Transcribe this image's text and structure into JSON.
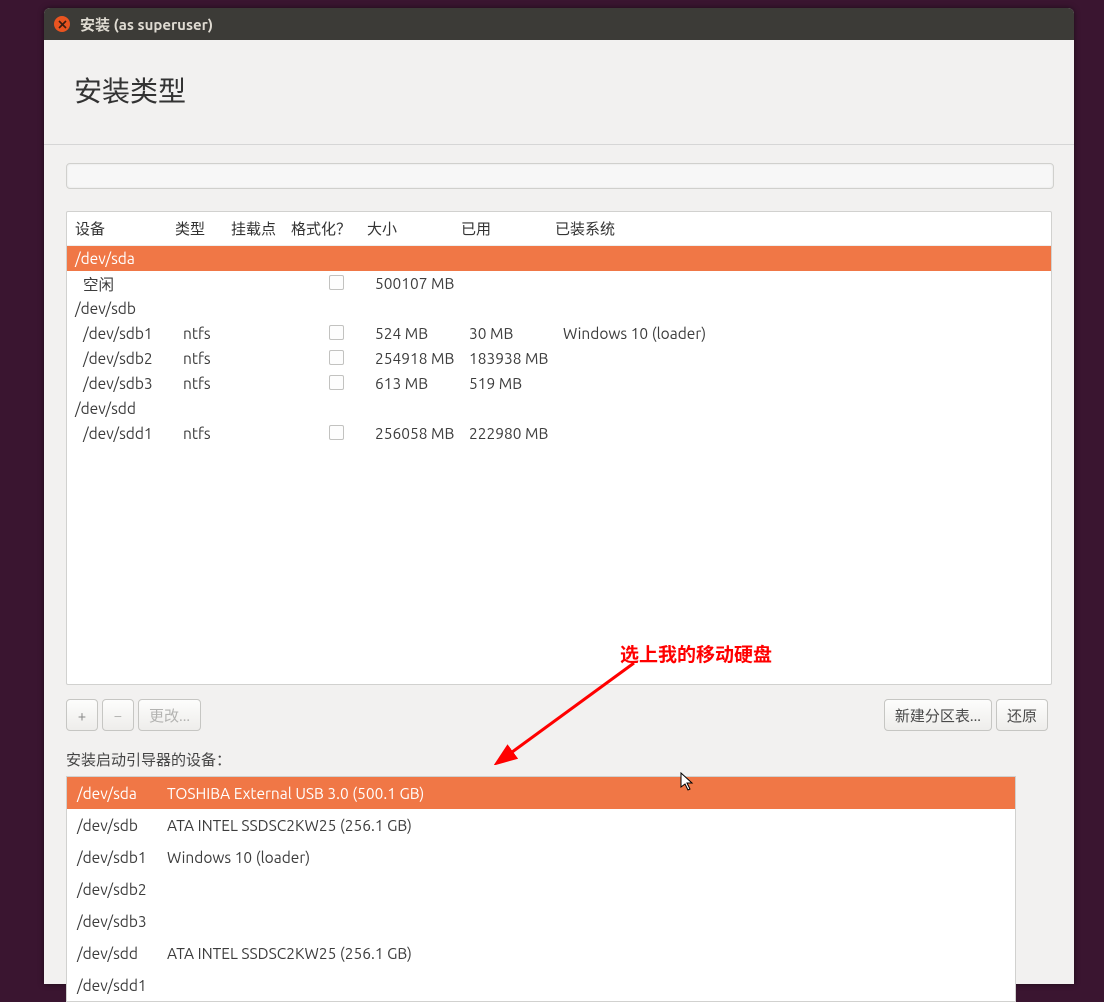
{
  "titlebar": {
    "title": "安装 (as superuser)"
  },
  "heading": "安装类型",
  "table": {
    "headers": {
      "device": "设备",
      "type": "类型",
      "mount": "挂载点",
      "format": "格式化？",
      "size": "大小",
      "used": "已用",
      "system": "已装系统"
    },
    "rows": [
      {
        "kind": "disk",
        "selected": true,
        "device": "/dev/sda"
      },
      {
        "kind": "child",
        "device": "空闲",
        "type": "",
        "format_box": true,
        "size": "500107 MB",
        "used": "",
        "system": ""
      },
      {
        "kind": "disk",
        "device": "/dev/sdb"
      },
      {
        "kind": "child",
        "device": "/dev/sdb1",
        "type": "ntfs",
        "format_box": true,
        "size": "524 MB",
        "used": "30 MB",
        "system": "Windows 10 (loader)"
      },
      {
        "kind": "child",
        "device": "/dev/sdb2",
        "type": "ntfs",
        "format_box": true,
        "size": "254918 MB",
        "used": "183938 MB",
        "system": ""
      },
      {
        "kind": "child",
        "device": "/dev/sdb3",
        "type": "ntfs",
        "format_box": true,
        "size": "613 MB",
        "used": "519 MB",
        "system": ""
      },
      {
        "kind": "disk",
        "device": "/dev/sdd"
      },
      {
        "kind": "child",
        "device": "/dev/sdd1",
        "type": "ntfs",
        "format_box": true,
        "size": "256058 MB",
        "used": "222980 MB",
        "system": ""
      }
    ]
  },
  "toolbar": {
    "add": "+",
    "remove": "−",
    "change": "更改...",
    "new_table": "新建分区表...",
    "revert": "还原"
  },
  "bootloader": {
    "label": "安装启动引导器的设备：",
    "options": [
      {
        "dev": "/dev/sda",
        "desc": "TOSHIBA External USB 3.0 (500.1 GB)",
        "selected": true
      },
      {
        "dev": "/dev/sdb",
        "desc": "ATA INTEL SSDSC2KW25 (256.1 GB)"
      },
      {
        "dev": "/dev/sdb1",
        "desc": "Windows 10 (loader)"
      },
      {
        "dev": "/dev/sdb2",
        "desc": ""
      },
      {
        "dev": "/dev/sdb3",
        "desc": ""
      },
      {
        "dev": "/dev/sdd",
        "desc": "ATA INTEL SSDSC2KW25 (256.1 GB)"
      },
      {
        "dev": "/dev/sdd1",
        "desc": ""
      }
    ]
  },
  "annotation": "选上我的移动硬盘"
}
